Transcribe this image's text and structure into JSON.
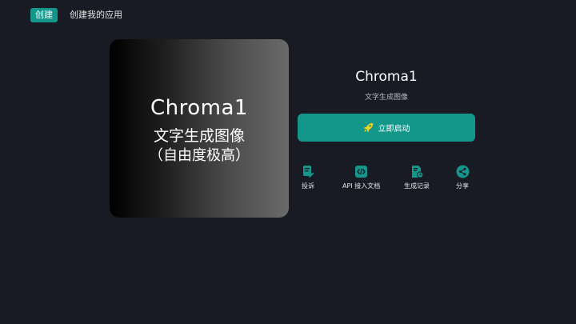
{
  "nav": {
    "tabs": [
      {
        "label": "创建",
        "active": true
      },
      {
        "label": "创建我的应用",
        "active": false
      }
    ]
  },
  "hero": {
    "title": "Chroma1",
    "subtitle": "文字生成图像",
    "note": "（自由度极高）"
  },
  "app": {
    "name": "Chroma1",
    "description": "文字生成图像",
    "launch_label": "立即启动"
  },
  "actions": [
    {
      "label": "投诉",
      "icon": "complaint-edit-icon"
    },
    {
      "label": "API 接入文档",
      "icon": "code-icon"
    },
    {
      "label": "生成记录",
      "icon": "history-icon"
    },
    {
      "label": "分享",
      "icon": "share-icon"
    }
  ],
  "colors": {
    "background": "#181a24",
    "accent": "#14978a"
  }
}
